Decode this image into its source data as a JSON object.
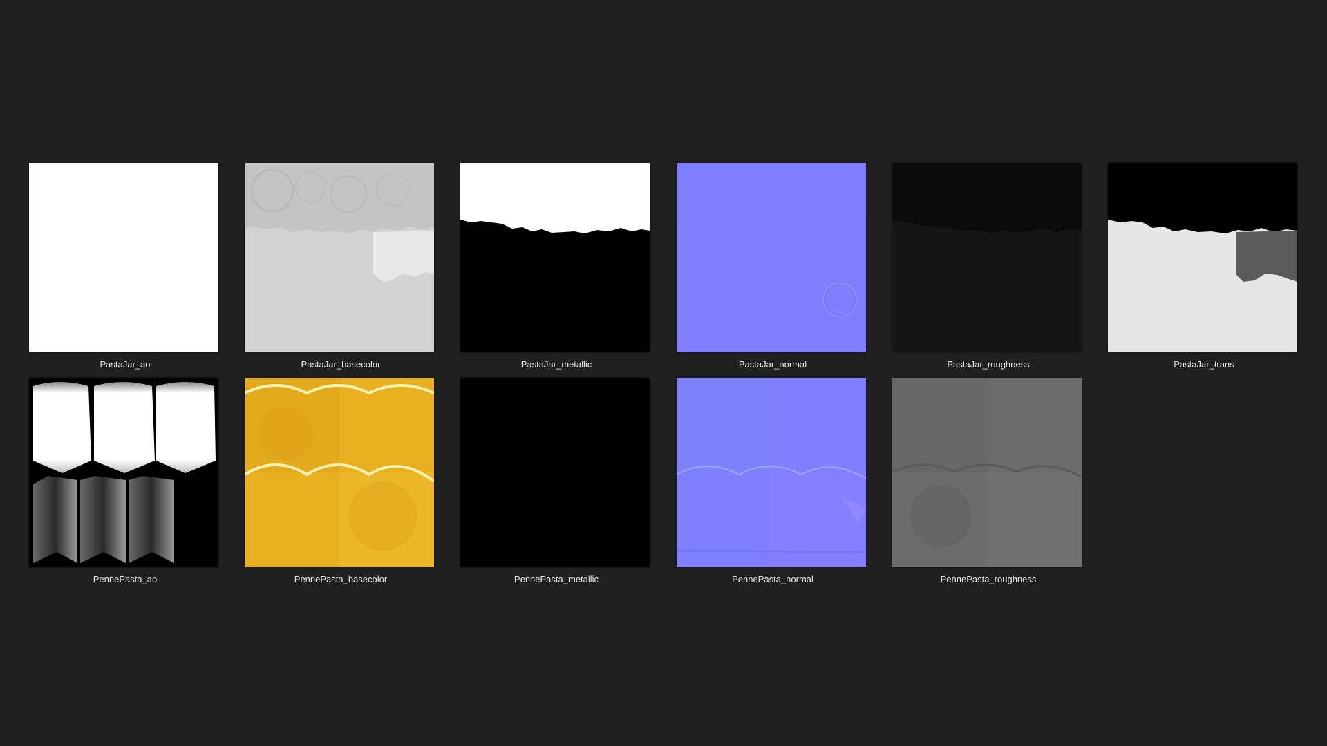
{
  "gallery": {
    "items": [
      {
        "label": "PastaJar_ao"
      },
      {
        "label": "PastaJar_basecolor"
      },
      {
        "label": "PastaJar_metallic"
      },
      {
        "label": "PastaJar_normal"
      },
      {
        "label": "PastaJar_roughness"
      },
      {
        "label": "PastaJar_trans"
      },
      {
        "label": "PennePasta_ao"
      },
      {
        "label": "PennePasta_basecolor"
      },
      {
        "label": "PennePasta_metallic"
      },
      {
        "label": "PennePasta_normal"
      },
      {
        "label": "PennePasta_roughness"
      }
    ]
  },
  "colors": {
    "background": "#202020",
    "label_text": "#e8e8e8",
    "normal_map": "#8080ff",
    "penne_basecolor": "#e8b020"
  }
}
